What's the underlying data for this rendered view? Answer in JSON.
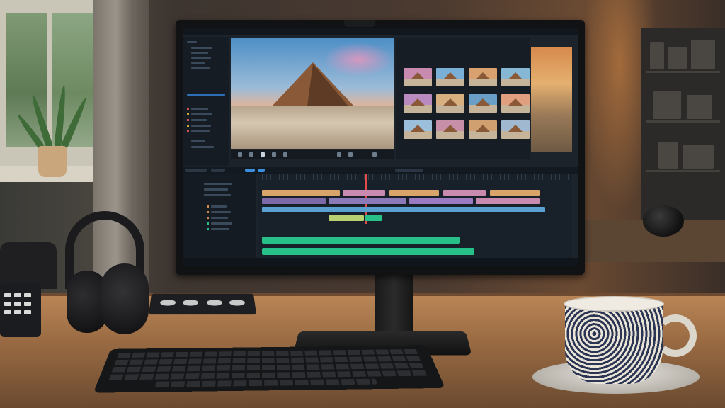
{
  "scene": {
    "description_label": "",
    "colors": {
      "accent_green": "#27c089",
      "playhead_red": "#e24b4b",
      "screen_bg": "#1c232b"
    }
  },
  "editor": {
    "top_bar_text": "",
    "media_pool_label": "",
    "status_text": "",
    "icons": [
      "play-icon",
      "pause-icon",
      "scissors-icon",
      "gear-icon"
    ]
  }
}
